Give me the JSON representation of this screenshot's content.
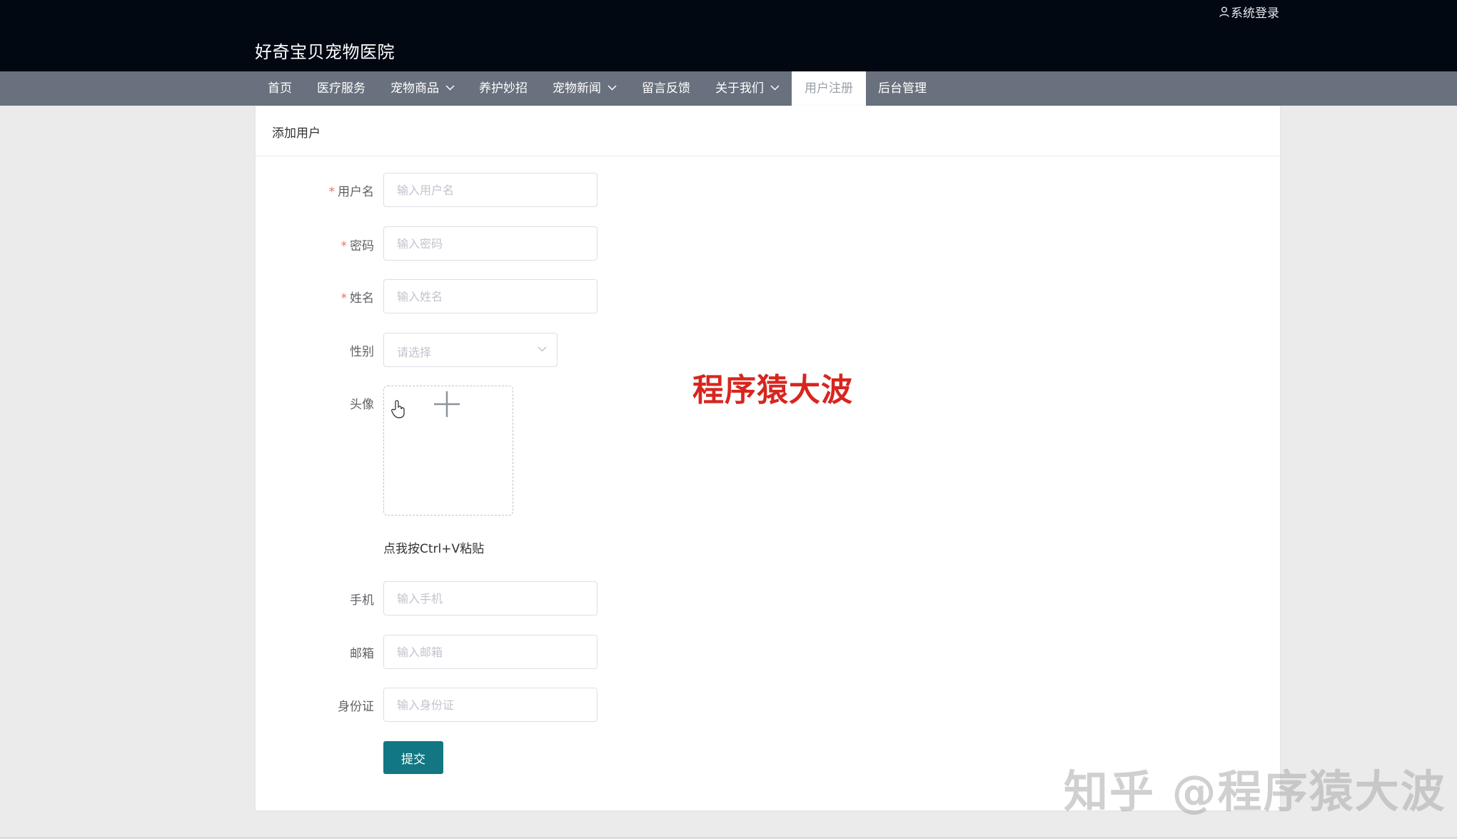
{
  "header": {
    "site_title": "好奇宝贝宠物医院",
    "login_label": "系统登录"
  },
  "nav": {
    "items": [
      {
        "label": "首页",
        "dropdown": false
      },
      {
        "label": "医疗服务",
        "dropdown": false
      },
      {
        "label": "宠物商品",
        "dropdown": true
      },
      {
        "label": "养护妙招",
        "dropdown": false
      },
      {
        "label": "宠物新闻",
        "dropdown": true
      },
      {
        "label": "留言反馈",
        "dropdown": false
      },
      {
        "label": "关于我们",
        "dropdown": true
      },
      {
        "label": "用户注册",
        "dropdown": false,
        "active": true
      },
      {
        "label": "后台管理",
        "dropdown": false
      }
    ]
  },
  "form": {
    "title": "添加用户",
    "username": {
      "label": "用户名",
      "placeholder": "输入用户名",
      "required": true
    },
    "password": {
      "label": "密码",
      "placeholder": "输入密码",
      "required": true
    },
    "name": {
      "label": "姓名",
      "placeholder": "输入姓名",
      "required": true
    },
    "gender": {
      "label": "性别",
      "placeholder": "请选择"
    },
    "avatar": {
      "label": "头像",
      "paste_hint": "点我按Ctrl+V粘贴"
    },
    "phone": {
      "label": "手机",
      "placeholder": "输入手机"
    },
    "email": {
      "label": "邮箱",
      "placeholder": "输入邮箱"
    },
    "idcard": {
      "label": "身份证",
      "placeholder": "输入身份证"
    },
    "submit_label": "提交",
    "required_mark": "*"
  },
  "watermarks": {
    "red_text": "程序猿大波",
    "zhihu_text": "知乎 @程序猿大波"
  },
  "colors": {
    "topbar": "#020812",
    "navbar": "#68717d",
    "primary_button": "#127782",
    "required": "#f56c6c",
    "watermark_red": "#d7261f"
  }
}
